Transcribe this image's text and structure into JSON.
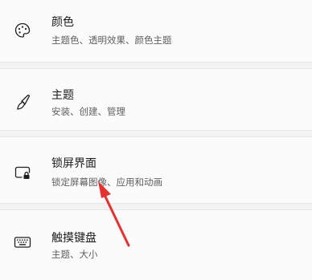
{
  "settings": {
    "items": [
      {
        "icon": "palette-icon",
        "title": "颜色",
        "description": "主题色、透明效果、颜色主题"
      },
      {
        "icon": "brush-icon",
        "title": "主题",
        "description": "安装、创建、管理"
      },
      {
        "icon": "lock-screen-icon",
        "title": "锁屏界面",
        "description": "锁定屏幕图像、应用和动画"
      },
      {
        "icon": "keyboard-icon",
        "title": "触摸键盘",
        "description": "主题、大小"
      }
    ]
  },
  "annotation": {
    "arrow_color": "#e8302e"
  }
}
